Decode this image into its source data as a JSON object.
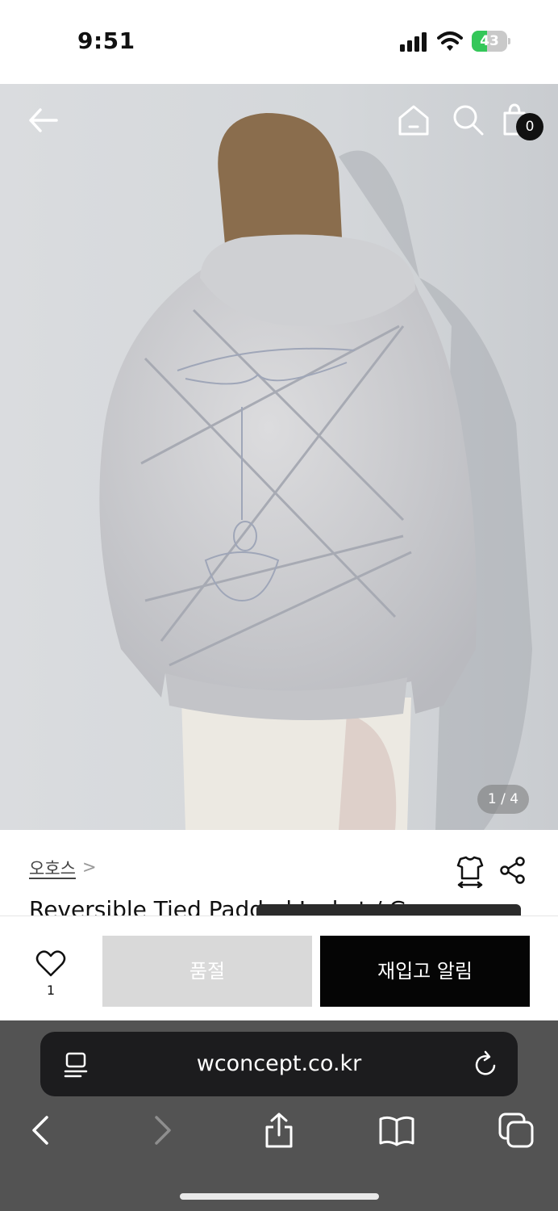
{
  "status_bar": {
    "time": "9:51",
    "battery": "43",
    "battery_level": 0.43
  },
  "product_gallery": {
    "counter": "1 / 4"
  },
  "header": {
    "cart_count": "0"
  },
  "product": {
    "brand": "오호스",
    "brand_chevron": ">",
    "title": "Reversible Tied Padded Jacket / Gray"
  },
  "actions": {
    "like_count": "1",
    "soldout_label": "품절",
    "restock_label": "재입고 알림"
  },
  "browser": {
    "url": "wconcept.co.kr"
  }
}
